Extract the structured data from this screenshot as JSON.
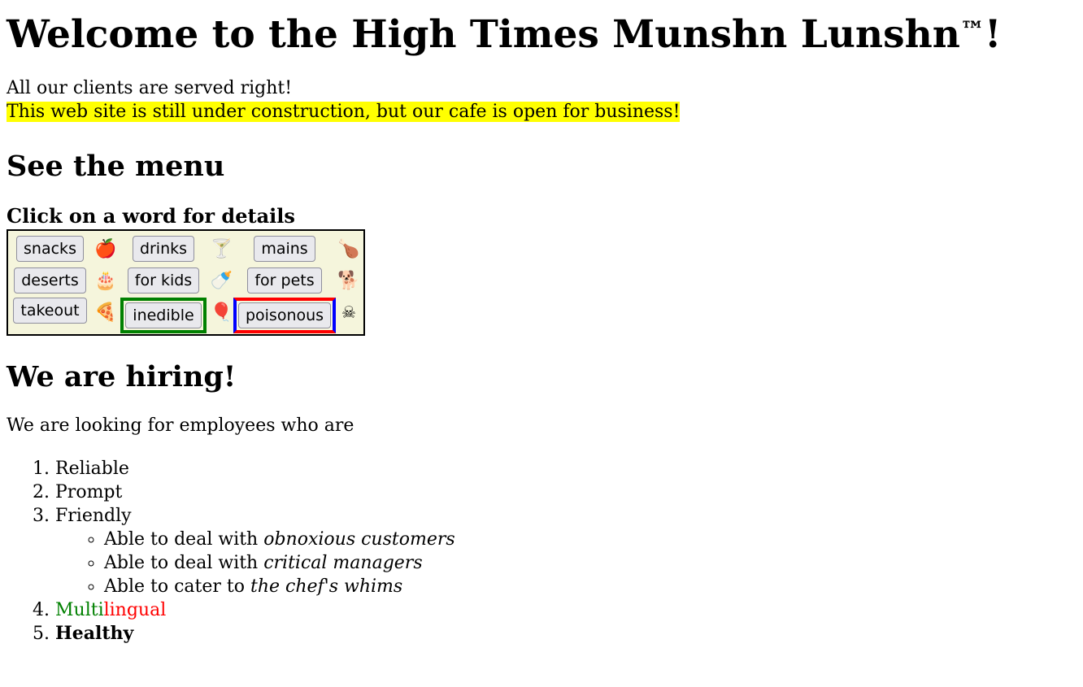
{
  "header": {
    "title": "Welcome to the High Times Munshn Lunshn",
    "trademark": "™",
    "exclaim": "!"
  },
  "intro": {
    "line1": "All our clients are served right!",
    "line2": "This web site is still under construction, but our cafe is open for business!"
  },
  "menu": {
    "heading": "See the menu",
    "subheading": "Click on a word for details",
    "items": [
      {
        "label": "snacks",
        "icon": "apple-icon",
        "glyph": "🍎"
      },
      {
        "label": "drinks",
        "icon": "cocktail-icon",
        "glyph": "🍸"
      },
      {
        "label": "mains",
        "icon": "drumstick-icon",
        "glyph": "🍗"
      },
      {
        "label": "deserts",
        "icon": "cake-icon",
        "glyph": "🎂"
      },
      {
        "label": "for kids",
        "icon": "baby-bottle-icon",
        "glyph": "🍼"
      },
      {
        "label": "for pets",
        "icon": "dog-icon",
        "glyph": "🐕"
      },
      {
        "label": "takeout",
        "icon": "pizza-icon",
        "glyph": "🍕"
      },
      {
        "label": "inedible",
        "icon": "balloon-icon",
        "glyph": "🎈"
      },
      {
        "label": "poisonous",
        "icon": "skull-crossbones-icon",
        "glyph": "☠"
      }
    ],
    "frame_colors": {
      "inedible": "#008000",
      "poisonous_sides": "#0000ff",
      "poisonous_top_bottom": "#ff0000"
    },
    "background": "#f5f5dc"
  },
  "hiring": {
    "heading": "We are hiring!",
    "intro": "We are looking for employees who are",
    "qualities": [
      "Reliable",
      "Prompt",
      "Friendly"
    ],
    "friendly_sub": [
      {
        "prefix": "Able to deal with ",
        "emph": "obnoxious customers"
      },
      {
        "prefix": "Able to deal with ",
        "emph": "critical managers"
      },
      {
        "prefix": "Able to cater to ",
        "emph": "the chef's whims"
      }
    ],
    "multilingual": {
      "part1": "Multi",
      "part2": "lingual",
      "color1": "#008000",
      "color2": "#ff0000"
    },
    "last": "Healthy"
  }
}
